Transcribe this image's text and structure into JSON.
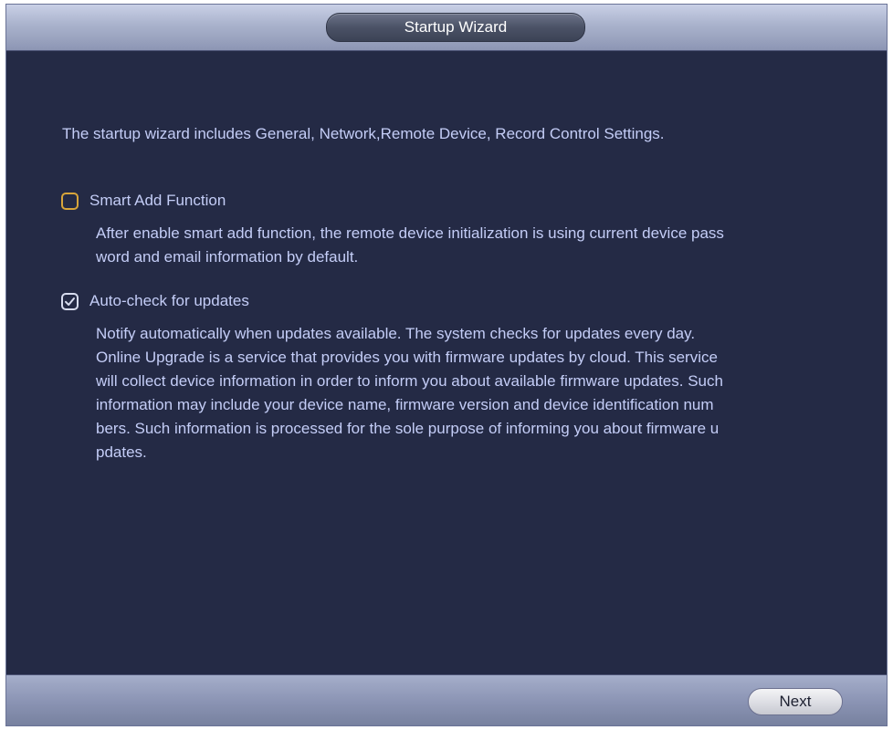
{
  "window": {
    "title": "Startup Wizard"
  },
  "content": {
    "intro": "The startup wizard includes General, Network,Remote Device, Record Control Settings.",
    "options": [
      {
        "label": "Smart Add Function",
        "checked": false,
        "description_lines": [
          "After enable smart add function, the remote device initialization is using current device pass",
          "word and email information by default."
        ]
      },
      {
        "label": "Auto-check for updates",
        "checked": true,
        "description_lines": [
          "Notify automatically when updates available. The system checks for updates every day.",
          "Online Upgrade is a service that provides you with firmware updates by cloud. This service",
          "will collect device information in order to inform you about available firmware updates. Such",
          " information may include your device name, firmware version and device identification num",
          "bers. Such information is processed for the sole purpose of informing you about firmware u",
          "pdates."
        ]
      }
    ]
  },
  "footer": {
    "next_label": "Next"
  },
  "colors": {
    "background": "#242a45",
    "text": "#c4cdf7",
    "unchecked_border": "#d8a53a",
    "checked_border": "#d7dcef"
  }
}
